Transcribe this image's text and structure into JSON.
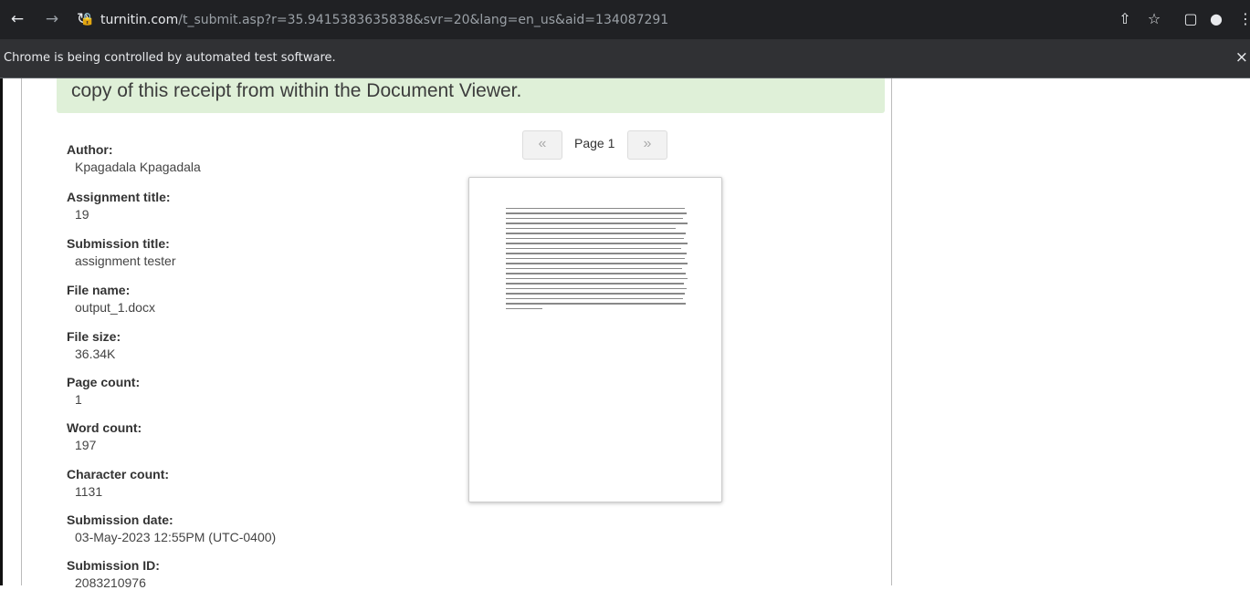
{
  "browser": {
    "url_host": "turnitin.com",
    "url_path": "/t_submit.asp?r=35.9415383635838&svr=20&lang=en_us&aid=134087291",
    "icons": [
      "back-icon",
      "forward-icon",
      "reload-icon",
      "lock-icon",
      "share-icon",
      "star-icon",
      "sidepanel-icon",
      "profile-icon",
      "menu-icon"
    ]
  },
  "infobar": {
    "message": "Chrome is being controlled by automated test software.",
    "close": "×"
  },
  "notice": {
    "text": "copy of this receipt from within the Document Viewer."
  },
  "pager": {
    "prev": "«",
    "label": "Page 1",
    "next": "»"
  },
  "submission": {
    "author_label": "Author:",
    "author": "Kpagadala Kpagadala",
    "assignment_title_label": "Assignment title:",
    "assignment_title": "19",
    "submission_title_label": "Submission title:",
    "submission_title": "assignment tester",
    "file_name_label": "File name:",
    "file_name": "output_1.docx",
    "file_size_label": "File size:",
    "file_size": "36.34K",
    "page_count_label": "Page count:",
    "page_count": "1",
    "word_count_label": "Word count:",
    "word_count": "197",
    "character_count_label": "Character count:",
    "character_count": "1131",
    "submission_date_label": "Submission date:",
    "submission_date": "03-May-2023 12:55PM (UTC-0400)",
    "submission_id_label": "Submission ID:",
    "submission_id": "2083210976"
  }
}
